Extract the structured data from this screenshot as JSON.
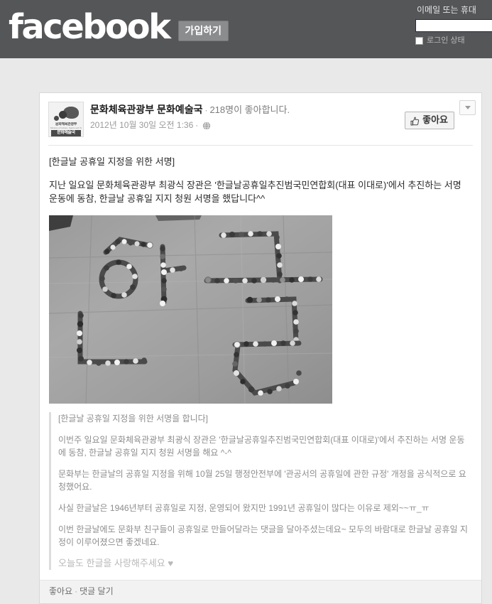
{
  "topbar": {
    "logo_text": "facebook",
    "signup_label": "가입하기",
    "login": {
      "email_label": "이메일 또는 휴대",
      "email_value": "",
      "email_placeholder": "",
      "persist_label": "로그인 상태"
    }
  },
  "post": {
    "author": {
      "name": "문화체육관광부 문화예술국",
      "avatar_logo_text": "문화체육관광부",
      "avatar_logo_sub": "Ministry of Culture, Sports and Tourism",
      "avatar_banner_text": "문화예술국"
    },
    "likes_text": "218명이 좋아합니다.",
    "timestamp": "2012년 10월 30일 오전 1:36",
    "privacy_icon": "globe-icon",
    "like_button_label": "좋아요",
    "like_button_icon": "thumbs-up-icon",
    "dropdown_icon": "chevron-down-icon",
    "title": "[한글날 공휴일 지정을 위한 서명]",
    "message": "지난 일요일 문화체육관광부 최광식 장관은 '한글날공휴일추진범국민연합회(대표 이대로)'에서 추진하는 서명 운동에 동참, 한글날 공휴일 지지 청원 서명을 했답니다^^",
    "photo_alt": "한글 모양으로 배열된 구슬 팔찌 사진",
    "quote": {
      "title": "[한글날 공휴일 지정을 위한 서명을 합니다]",
      "paragraphs": [
        "이번주 일요일 문화체육관광부 최광식 장관은 '한글날공휴일추진범국민연합회(대표 이대로)'에서 추진하는 서명 운동에 동참, 한글날 공휴일 지지 청원 서명을 해요 ^-^",
        "문화부는 한글날의 공휴일 지정을 위해 10월 25일 행정안전부에 '관공서의 공휴일에 관한 규정' 개정을 공식적으로 요청했어요.",
        "사실 한글날은 1946년부터 공휴일로 지정, 운영되어 왔지만 1991년 공휴일이 많다는 이유로 제외~~ㅠ_ㅠ",
        "이번 한글날에도 문화부 친구들이 공휴일로 만들어달라는 댓글을 달아주셨는데요~ 모두의 바람대로 한글날 공휴일 지정이 이루어졌으면 좋겠네요.",
        "오늘도 한글을 사랑해주세요 ♥"
      ]
    },
    "footer": {
      "like_label": "좋아요",
      "separator": "·",
      "comment_label": "댓글 달기"
    }
  },
  "colors": {
    "topbar_bg": "#555658",
    "page_bg": "#e9e9e9",
    "card_bg": "#ffffff",
    "muted_text": "#8d8d8d"
  }
}
